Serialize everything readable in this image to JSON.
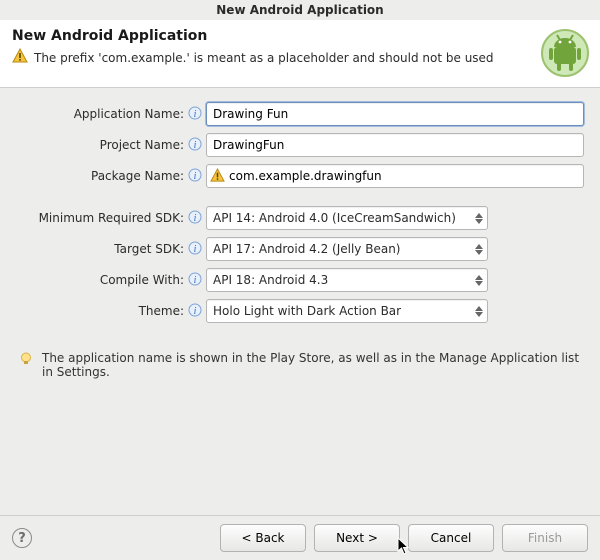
{
  "window_title": "New Android Application",
  "banner": {
    "title": "New Android Application",
    "warning": "The prefix 'com.example.' is meant as a placeholder and should not be used"
  },
  "fields": {
    "app_name": {
      "label": "Application Name:",
      "value": "Drawing Fun"
    },
    "project_name": {
      "label": "Project Name:",
      "value": "DrawingFun"
    },
    "package_name": {
      "label": "Package Name:",
      "value": "com.example.drawingfun"
    },
    "min_sdk": {
      "label": "Minimum Required SDK:",
      "value": "API 14: Android 4.0 (IceCreamSandwich)"
    },
    "target_sdk": {
      "label": "Target SDK:",
      "value": "API 17: Android 4.2 (Jelly Bean)"
    },
    "compile_with": {
      "label": "Compile With:",
      "value": "API 18: Android 4.3"
    },
    "theme": {
      "label": "Theme:",
      "value": "Holo Light with Dark Action Bar"
    }
  },
  "hint": "The application name is shown in the Play Store, as well as in the Manage Application list in Settings.",
  "buttons": {
    "help": "?",
    "back": "< Back",
    "next": "Next >",
    "cancel": "Cancel",
    "finish": "Finish"
  }
}
